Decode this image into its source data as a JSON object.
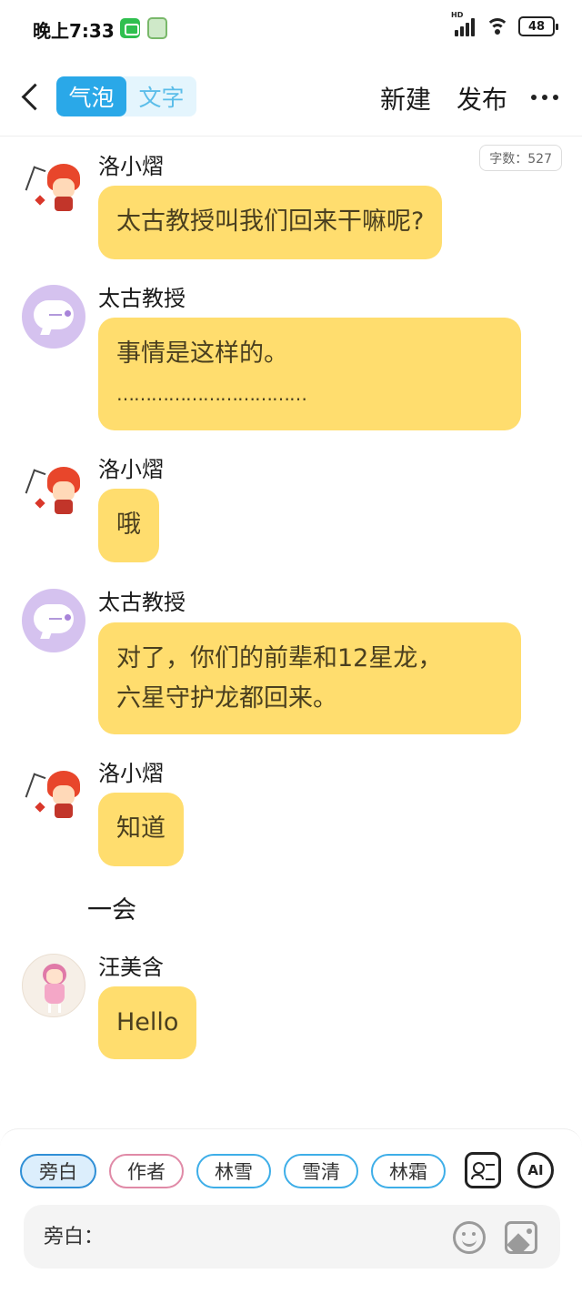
{
  "status_bar": {
    "time": "晚上7:33",
    "network_label": "HD",
    "battery": "48"
  },
  "header": {
    "tabs": [
      {
        "label": "气泡",
        "active": true
      },
      {
        "label": "文字",
        "active": false
      }
    ],
    "new_label": "新建",
    "publish_label": "发布",
    "accent_color": "#2aa8e8"
  },
  "chat": {
    "word_count": "字数：527",
    "bubble_color": "#ffdd6e",
    "messages": [
      {
        "sender": "洛小熠",
        "avatar": "anime-boy-red-hair",
        "lines": [
          "太古教授叫我们回来干嘛呢?"
        ]
      },
      {
        "sender": "太古教授",
        "avatar": "purple-chat-bot",
        "lines": [
          "事情是这样的。",
          "……………………………"
        ]
      },
      {
        "sender": "洛小熠",
        "avatar": "anime-boy-red-hair",
        "lines": [
          "哦"
        ]
      },
      {
        "sender": "太古教授",
        "avatar": "purple-chat-bot",
        "lines": [
          "对了，你们的前辈和12星龙，",
          "六星守护龙都回来。"
        ]
      },
      {
        "sender": "洛小熠",
        "avatar": "anime-boy-red-hair",
        "lines": [
          "知道"
        ]
      },
      {
        "sender": "汪美含",
        "avatar": "anime-girl-pink-hair",
        "lines": [
          "Hello"
        ]
      }
    ],
    "narration": "一会"
  },
  "bottom_bar": {
    "chips": [
      {
        "label": "旁白",
        "active": true
      },
      {
        "label": "作者",
        "active": false
      },
      {
        "label": "林雪",
        "active": false
      },
      {
        "label": "雪清",
        "active": false
      },
      {
        "label": "林霜",
        "active": false
      }
    ],
    "character_card_icon": "contact-card-icon",
    "ai_label": "AI",
    "input_placeholder": "旁白："
  }
}
